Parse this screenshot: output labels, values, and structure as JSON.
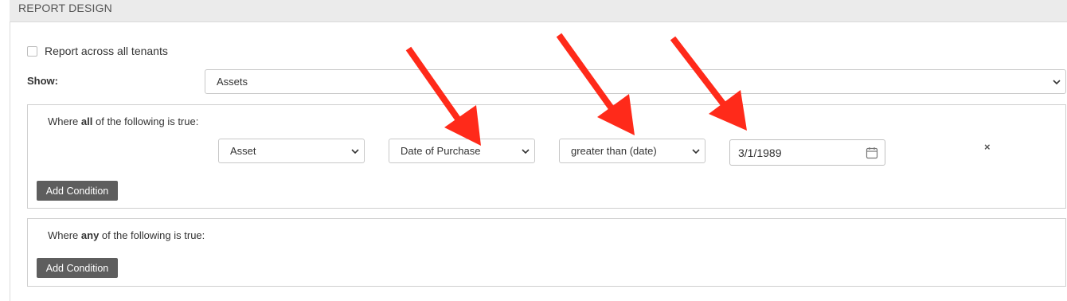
{
  "panel": {
    "title": "REPORT DESIGN"
  },
  "tenants": {
    "label": "Report across all tenants",
    "checked": false
  },
  "show": {
    "label": "Show:",
    "value": "Assets"
  },
  "all_group": {
    "prefix": "Where ",
    "keyword": "all",
    "suffix": " of the following is true:",
    "condition": {
      "entity": "Asset",
      "field": "Date of Purchase",
      "operator": "greater than (date)",
      "value": "3/1/1989",
      "remove_icon": "×"
    },
    "add_button": "Add Condition"
  },
  "any_group": {
    "prefix": "Where ",
    "keyword": "any",
    "suffix": " of the following is true:",
    "add_button": "Add Condition"
  },
  "annotations": {
    "arrow_color": "#ff2a1a"
  },
  "icons": {
    "select_chevron": "chevron-down-icon",
    "date_picker": "calendar-icon",
    "remove": "close-icon"
  }
}
